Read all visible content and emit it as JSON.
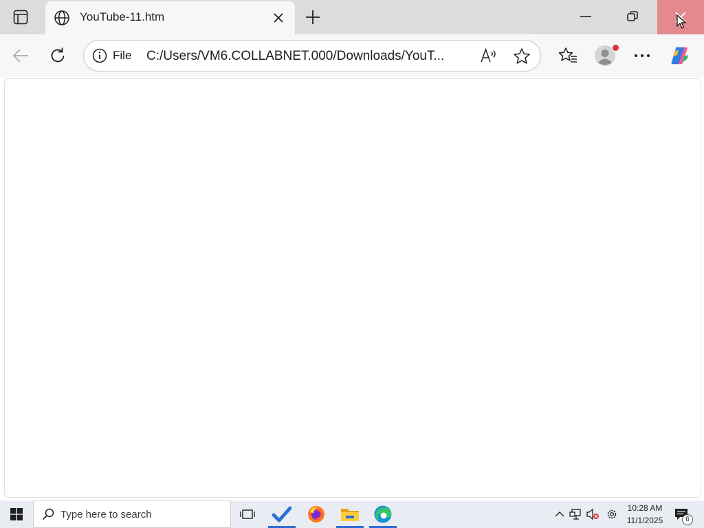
{
  "browser": {
    "tab": {
      "title": "YouTube-11.htm",
      "favicon": "globe-icon"
    },
    "address_bar": {
      "site_info_label": "File",
      "url": "C:/Users/VM6.COLLABNET.000/Downloads/YouT..."
    },
    "icons": {
      "tab_actions": "tab-actions-icon",
      "tab_close": "close-icon",
      "new_tab": "plus-icon",
      "minimize": "minimize-icon",
      "restore": "restore-icon",
      "close_window": "close-icon",
      "back": "back-arrow-icon",
      "refresh": "refresh-icon",
      "read_aloud": "read-aloud-icon",
      "favorite": "star-icon",
      "favorites": "favorites-icon",
      "profile": "profile-avatar-icon",
      "more": "more-dots-icon",
      "copilot": "copilot-icon"
    },
    "colors": {
      "close_hover": "#e38a8f",
      "tab_strip": "#dcdcdc",
      "toolbar": "#f7f7f7",
      "profile_badge": "#e0303a"
    }
  },
  "taskbar": {
    "search_placeholder": "Type here to search",
    "apps": [
      "task-view-icon",
      "todo-check-icon",
      "firefox-icon",
      "file-explorer-icon",
      "edge-icon"
    ],
    "tray_icons": [
      "chevron-up-icon",
      "network-icon",
      "volume-muted-icon",
      "settings-gear-icon"
    ],
    "clock": {
      "time": "10:28 AM",
      "date": "11/1/2025"
    },
    "notification_count": "6"
  }
}
